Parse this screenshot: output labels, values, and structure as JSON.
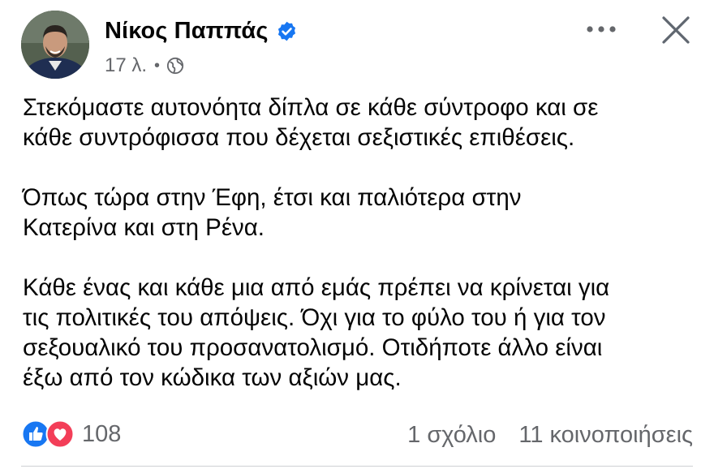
{
  "post": {
    "author": "Νίκος Παππάς",
    "verified": true,
    "time": "17 λ.",
    "privacy_icon": "globe-icon",
    "paragraphs": [
      "Στεκόμαστε αυτονόητα δίπλα σε κάθε σύντροφο και σε\nκάθε συντρόφισσα που δέχεται σεξιστικές επιθέσεις.",
      "Όπως τώρα στην Έφη, έτσι και  παλιότερα στην\nΚατερίνα και στη Ρένα.",
      "Κάθε ένας και κάθε μια από εμάς πρέπει να κρίνεται για\nτις πολιτικές του απόψεις. Όχι για το φύλο του ή για τον\nσεξουαλικό του προσανατολισμό. Οτιδήποτε άλλο είναι\nέξω από τον κώδικα των αξιών μας."
    ],
    "reactions": {
      "icons": [
        "like-icon",
        "love-icon"
      ],
      "count": "108"
    },
    "comments": "1 σχόλιο",
    "shares": "11 κοινοποιήσεις"
  },
  "header": {
    "more_icon": "more-horizontal-icon",
    "close_icon": "close-icon"
  },
  "colors": {
    "verified": "#1877f2",
    "like": "#1877f2",
    "love": "#f33e58",
    "secondary_text": "#65676b"
  }
}
